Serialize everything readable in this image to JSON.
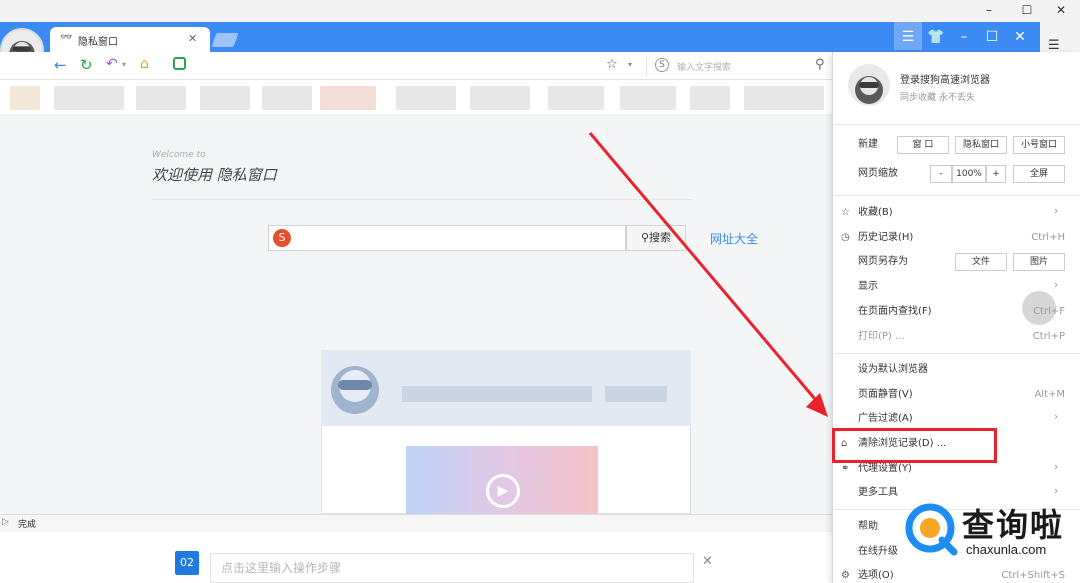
{
  "tab": {
    "title": "隐私窗口"
  },
  "address_bar": {
    "search_placeholder": "输入文字搜索"
  },
  "page": {
    "welcome_en": "Welcome to",
    "welcome_zh": "欢迎使用 隐私窗口",
    "search_button": "搜索",
    "link_all_sites": "网址大全"
  },
  "statusbar": {
    "text": "完成"
  },
  "menu": {
    "login_title": "登录搜狗高速浏览器",
    "login_sub": "同步收藏 永不丢失",
    "new_label": "新建",
    "new_buttons": [
      "窗 口",
      "隐私窗口",
      "小号窗口"
    ],
    "zoom_label": "网页缩放",
    "zoom_minus": "-",
    "zoom_value": "100%",
    "zoom_plus": "+",
    "fullscreen": "全屏",
    "favorites": "收藏(B)",
    "history": "历史记录(H)",
    "history_shortcut": "Ctrl+H",
    "save_as": "网页另存为",
    "save_file": "文件",
    "save_image": "图片",
    "display": "显示",
    "find": "在页面内查找(F)",
    "find_shortcut": "Ctrl+F",
    "print": "打印(P) ...",
    "print_shortcut": "Ctrl+P",
    "set_default": "设为默认浏览器",
    "mute": "页面静音(V)",
    "mute_shortcut": "Alt+M",
    "ad_filter": "广告过滤(A)",
    "clear_history": "清除浏览记录(D) ...",
    "proxy": "代理设置(Y)",
    "more_tools": "更多工具",
    "help": "帮助",
    "upgrade": "在线升级",
    "options": "选项(O)",
    "options_shortcut": "Ctrl+Shift+S"
  },
  "instruction": {
    "step_number": "02",
    "placeholder": "点击这里输入操作步骤",
    "close": "✕"
  },
  "watermark": {
    "text": "查询啦",
    "url": "chaxunla.com"
  },
  "colors": {
    "titlebar": "#3c8af4",
    "highlight": "#e8232c",
    "arrow": "#e8232c",
    "badge": "#1f7ae0"
  }
}
